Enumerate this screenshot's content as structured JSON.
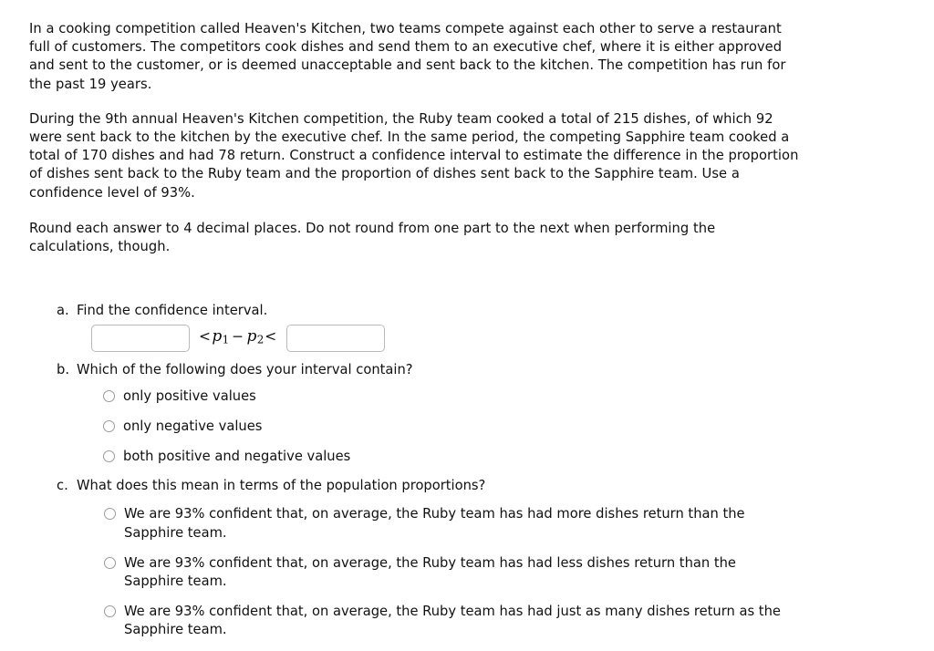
{
  "problem": {
    "paragraph1": "In a cooking competition called Heaven's Kitchen, two teams compete against each other to serve a restaurant full of customers. The competitors cook dishes and send them to an executive chef, where it is either approved and sent to the customer, or is deemed unacceptable and sent back to the kitchen. The competition has run for the past 19 years.",
    "paragraph2": "During the 9th annual Heaven's Kitchen competition, the Ruby team cooked a total of 215 dishes, of which 92 were sent back to the kitchen by the executive chef. In the same period, the competing Sapphire team cooked a total of 170 dishes and had 78 return. Construct a confidence interval to estimate the difference in the proportion of dishes sent back to the Ruby team and the proportion of dishes sent back to the Sapphire team. Use a confidence level of 93%.",
    "paragraph3": "Round each answer to 4 decimal places. Do not round from one part to the next when performing the calculations, though."
  },
  "parts": {
    "a": {
      "marker": "a.",
      "prompt": "Find the confidence interval.",
      "lower_value": "",
      "lower_placeholder": "",
      "upper_value": "",
      "upper_placeholder": "",
      "math": {
        "less_than_left": "<",
        "p1": "p",
        "p1_sub": "1",
        "minus": "−",
        "p2": "p",
        "p2_sub": "2",
        "less_than_right": "<"
      }
    },
    "b": {
      "marker": "b.",
      "prompt": "Which of the following does your interval contain?",
      "options": [
        "only positive values",
        "only negative values",
        "both positive and negative values"
      ]
    },
    "c": {
      "marker": "c.",
      "prompt": "What does this mean in terms of the population proportions?",
      "options": [
        "We are 93% confident that, on average, the Ruby team has had more dishes return than the Sapphire team.",
        "We are 93% confident that, on average, the Ruby team has had less dishes return than the Sapphire team.",
        "We are 93% confident that, on average, the Ruby team has had just as many dishes return as the Sapphire team."
      ]
    }
  }
}
